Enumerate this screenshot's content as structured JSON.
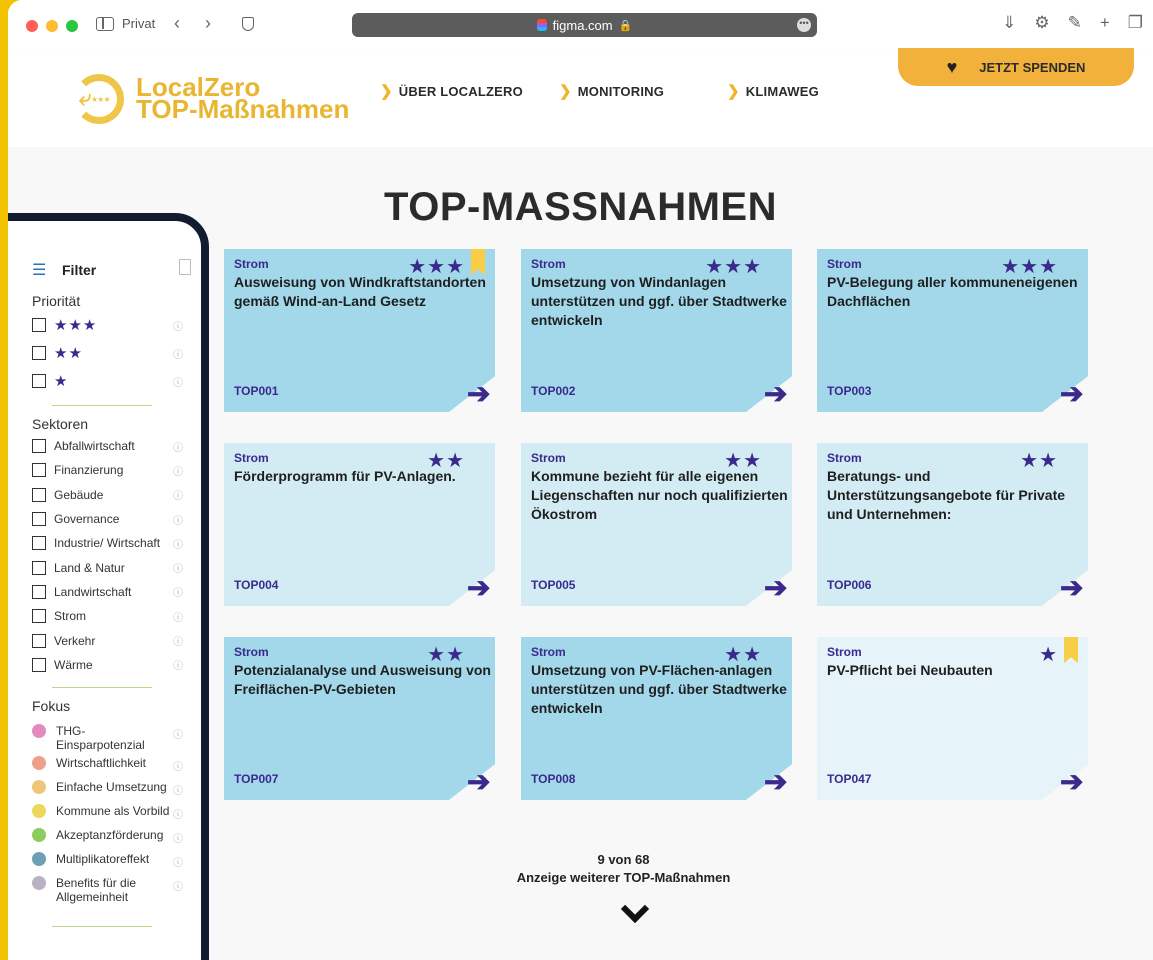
{
  "browser": {
    "profile": "Privat",
    "url": "figma.com",
    "lock": "🔒",
    "more": "•••"
  },
  "header": {
    "logo_line1": "LocalZero",
    "logo_line2": "TOP-Maßnahmen",
    "nav": [
      "ÜBER LOCALZERO",
      "MONITORING",
      "KLIMAWEG"
    ],
    "donate": "JETZT SPENDEN"
  },
  "page": {
    "title": "TOP-MASSNAHMEN"
  },
  "filter": {
    "title": "Filter",
    "priority_title": "Priorität",
    "priorities": [
      "★★★",
      "★★",
      "★"
    ],
    "sectors_title": "Sektoren",
    "sectors": [
      "Abfallwirtschaft",
      "Finanzierung",
      "Gebäude",
      "Governance",
      "Industrie/ Wirtschaft",
      "Land & Natur",
      "Landwirtschaft",
      "Strom",
      "Verkehr",
      "Wärme"
    ],
    "focus_title": "Fokus",
    "focus": [
      {
        "label": "THG-Einsparpotenzial",
        "color": "#e58ac0"
      },
      {
        "label": "Wirtschaftlichkeit",
        "color": "#eea08a"
      },
      {
        "label": "Einfache Umsetzung",
        "color": "#efc57a"
      },
      {
        "label": "Kommune als Vorbild",
        "color": "#ebd85a"
      },
      {
        "label": "Akzeptanzförderung",
        "color": "#8dcc5e"
      },
      {
        "label": "Multiplikatoreffekt",
        "color": "#6f9fb4"
      },
      {
        "label": "Benefits für die Allgemeinheit",
        "color": "#b9b2c5"
      }
    ],
    "info_glyph": "ⓘ"
  },
  "cards": [
    {
      "sector": "Strom",
      "title": "Ausweisung von Windkraftstandorten gemäß Wind-an-Land Gesetz",
      "code": "TOP001",
      "stars": "★★★",
      "bookmark": true,
      "style": "dark"
    },
    {
      "sector": "Strom",
      "title": "Umsetzung von Windanlagen unterstützen und ggf. über Stadtwerke entwickeln",
      "code": "TOP002",
      "stars": "★★★",
      "bookmark": false,
      "style": "dark"
    },
    {
      "sector": "Strom",
      "title": "PV-Belegung aller kommuneneigenen Dachflächen",
      "code": "TOP003",
      "stars": "★★★",
      "bookmark": false,
      "style": "dark"
    },
    {
      "sector": "Strom",
      "title": "Förderprogramm für PV-Anlagen.",
      "code": "TOP004",
      "stars": "★★",
      "bookmark": false,
      "style": "light"
    },
    {
      "sector": "Strom",
      "title": "Kommune bezieht für alle eigenen Liegenschaften nur noch qualifizierten Ökostrom",
      "code": "TOP005",
      "stars": "★★",
      "bookmark": false,
      "style": "light"
    },
    {
      "sector": "Strom",
      "title": "Beratungs- und Unterstützungsangebote für Private und Unternehmen:",
      "code": "TOP006",
      "stars": "★★",
      "bookmark": false,
      "style": "light"
    },
    {
      "sector": "Strom",
      "title": "Potenzialanalyse und Ausweisung von Freiflächen-PV-Gebieten",
      "code": "TOP007",
      "stars": "★★",
      "bookmark": false,
      "style": "dark"
    },
    {
      "sector": "Strom",
      "title": "Umsetzung von PV-Flächen-anlagen unterstützen und ggf. über Stadtwerke entwickeln",
      "code": "TOP008",
      "stars": "★★",
      "bookmark": false,
      "style": "dark"
    },
    {
      "sector": "Strom",
      "title": "PV-Pflicht bei Neubauten",
      "code": "TOP047",
      "stars": "★",
      "bookmark": true,
      "style": "extralight"
    }
  ],
  "pager": {
    "count": "9 von 68",
    "more": "Anzeige weiterer TOP-Maßnahmen"
  }
}
